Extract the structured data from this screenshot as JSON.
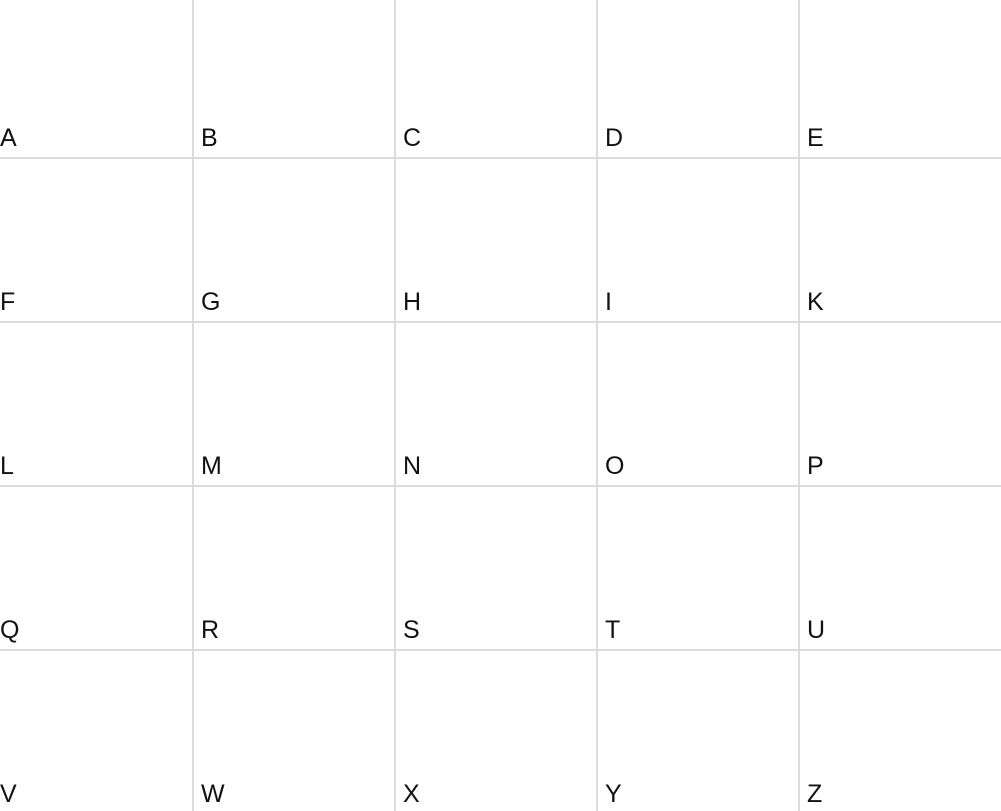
{
  "grid": {
    "rows": [
      [
        "A",
        "B",
        "C",
        "D",
        "E"
      ],
      [
        "F",
        "G",
        "H",
        "I",
        "K"
      ],
      [
        "L",
        "M",
        "N",
        "O",
        "P"
      ],
      [
        "Q",
        "R",
        "S",
        "T",
        "U"
      ],
      [
        "V",
        "W",
        "X",
        "Y",
        "Z"
      ]
    ]
  },
  "colors": {
    "background": "#ffffff",
    "grid_line": "#dcdcdc",
    "text": "#111111"
  }
}
